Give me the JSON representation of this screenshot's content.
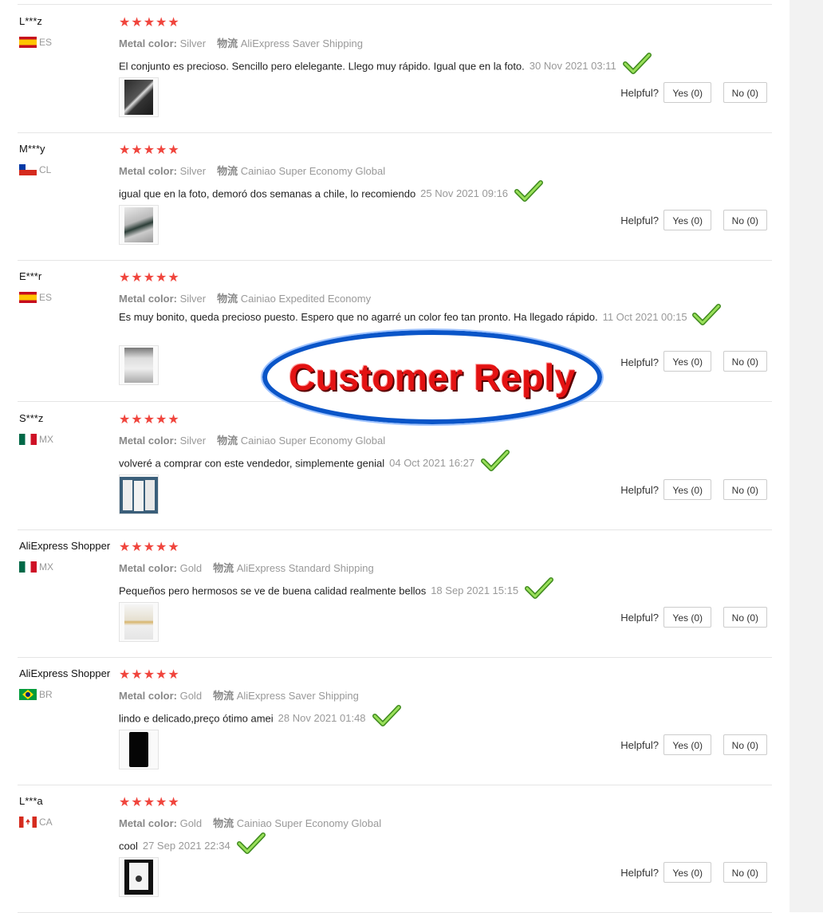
{
  "overlay": {
    "text": "Customer Reply"
  },
  "labels": {
    "helpful": "Helpful?",
    "metal_color": "Metal color:",
    "logistics": "物流"
  },
  "reviews": [
    {
      "user": "L***z",
      "country": "ES",
      "flag": "spain-flag-icon",
      "stars": "★★★★★",
      "metal": "Silver",
      "shipping": "AliExpress Saver Shipping",
      "text": "El conjunto es precioso. Sencillo pero elelegante. Llego muy rápido. Igual que en la foto.",
      "date": "30 Nov 2021 03:11",
      "yes": "Yes (0)",
      "no": "No (0)"
    },
    {
      "user": "M***y",
      "country": "CL",
      "flag": "chile-flag-icon",
      "stars": "★★★★★",
      "metal": "Silver",
      "shipping": "Cainiao Super Economy Global",
      "text": "igual que en la foto, demoró dos semanas a chile, lo recomiendo",
      "date": "25 Nov 2021 09:16",
      "yes": "Yes (0)",
      "no": "No (0)"
    },
    {
      "user": "E***r",
      "country": "ES",
      "flag": "spain-flag-icon",
      "stars": "★★★★★",
      "metal": "Silver",
      "shipping": "Cainiao Expedited Economy",
      "text": "Es muy bonito, queda precioso puesto. Espero que no agarré un color feo tan pronto. Ha llegado rápido.",
      "date": "11 Oct 2021 00:15",
      "yes": "Yes (0)",
      "no": "No (0)"
    },
    {
      "user": "S***z",
      "country": "MX",
      "flag": "mexico-flag-icon",
      "stars": "★★★★★",
      "metal": "Silver",
      "shipping": "Cainiao Super Economy Global",
      "text": "volveré a comprar con este vendedor, simplemente genial",
      "date": "04 Oct 2021 16:27",
      "yes": "Yes (0)",
      "no": "No (0)"
    },
    {
      "user": "AliExpress Shopper",
      "country": "MX",
      "flag": "mexico-flag-icon",
      "stars": "★★★★★",
      "metal": "Gold",
      "shipping": "AliExpress Standard Shipping",
      "text": "Pequeños pero hermosos se ve de buena calidad realmente bellos",
      "date": "18 Sep 2021 15:15",
      "yes": "Yes (0)",
      "no": "No (0)"
    },
    {
      "user": "AliExpress Shopper",
      "country": "BR",
      "flag": "brazil-flag-icon",
      "stars": "★★★★★",
      "metal": "Gold",
      "shipping": "AliExpress Saver Shipping",
      "text": "lindo e delicado,preço ótimo amei",
      "date": "28 Nov 2021 01:48",
      "yes": "Yes (0)",
      "no": "No (0)"
    },
    {
      "user": "L***a",
      "country": "CA",
      "flag": "canada-flag-icon",
      "stars": "★★★★★",
      "metal": "Gold",
      "shipping": "Cainiao Super Economy Global",
      "text": "cool",
      "date": "27 Sep 2021 22:34",
      "yes": "Yes (0)",
      "no": "No (0)"
    }
  ]
}
